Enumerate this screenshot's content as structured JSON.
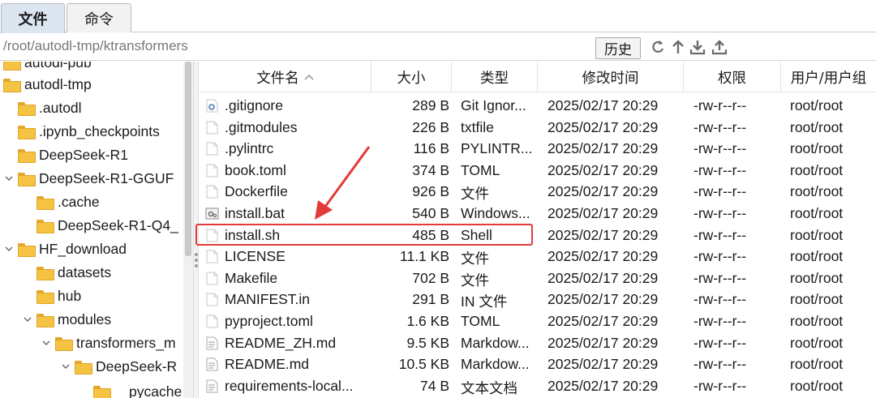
{
  "tabs": [
    {
      "label": "文件",
      "active": true
    },
    {
      "label": "命令",
      "active": false
    }
  ],
  "pathbar": {
    "path": "/root/autodl-tmp/ktransformers",
    "history_label": "历史"
  },
  "tree": {
    "items": [
      {
        "label": "autodl-pub",
        "depth": 0,
        "expanded": false,
        "clipped_top": true
      },
      {
        "label": "autodl-tmp",
        "depth": 0,
        "expanded": true
      },
      {
        "label": ".autodl",
        "depth": 1,
        "expanded": false
      },
      {
        "label": ".ipynb_checkpoints",
        "depth": 1,
        "expanded": false
      },
      {
        "label": "DeepSeek-R1",
        "depth": 1,
        "expanded": false
      },
      {
        "label": "DeepSeek-R1-GGUF",
        "depth": 1,
        "expanded": true
      },
      {
        "label": ".cache",
        "depth": 2,
        "expanded": false
      },
      {
        "label": "DeepSeek-R1-Q4_",
        "depth": 2,
        "expanded": false
      },
      {
        "label": "HF_download",
        "depth": 1,
        "expanded": true
      },
      {
        "label": "datasets",
        "depth": 2,
        "expanded": false
      },
      {
        "label": "hub",
        "depth": 2,
        "expanded": false
      },
      {
        "label": "modules",
        "depth": 2,
        "expanded": true
      },
      {
        "label": "transformers_m",
        "depth": 3,
        "expanded": true
      },
      {
        "label": "DeepSeek-R",
        "depth": 4,
        "expanded": true
      },
      {
        "label": "pycache",
        "depth": 5,
        "expanded": false
      }
    ]
  },
  "file_list": {
    "columns": [
      "文件名",
      "大小",
      "类型",
      "修改时间",
      "权限",
      "用户/用户组"
    ],
    "rows": [
      {
        "name": ".gitignore",
        "size": "289 B",
        "type": "Git Ignor...",
        "modified": "2025/02/17 20:29",
        "perm": "-rw-r--r--",
        "owner": "root/root",
        "icon": "settings-file-icon"
      },
      {
        "name": ".gitmodules",
        "size": "226 B",
        "type": "txtfile",
        "modified": "2025/02/17 20:29",
        "perm": "-rw-r--r--",
        "owner": "root/root",
        "icon": "file-icon"
      },
      {
        "name": ".pylintrc",
        "size": "116 B",
        "type": "PYLINTR...",
        "modified": "2025/02/17 20:29",
        "perm": "-rw-r--r--",
        "owner": "root/root",
        "icon": "file-icon"
      },
      {
        "name": "book.toml",
        "size": "374 B",
        "type": "TOML",
        "modified": "2025/02/17 20:29",
        "perm": "-rw-r--r--",
        "owner": "root/root",
        "icon": "file-icon"
      },
      {
        "name": "Dockerfile",
        "size": "926 B",
        "type": "文件",
        "modified": "2025/02/17 20:29",
        "perm": "-rw-r--r--",
        "owner": "root/root",
        "icon": "file-icon"
      },
      {
        "name": "install.bat",
        "size": "540 B",
        "type": "Windows...",
        "modified": "2025/02/17 20:29",
        "perm": "-rw-r--r--",
        "owner": "root/root",
        "icon": "batch-file-icon"
      },
      {
        "name": "install.sh",
        "size": "485 B",
        "type": "Shell",
        "modified": "2025/02/17 20:29",
        "perm": "-rw-r--r--",
        "owner": "root/root",
        "icon": "file-icon",
        "highlighted": true
      },
      {
        "name": "LICENSE",
        "size": "11.1 KB",
        "type": "文件",
        "modified": "2025/02/17 20:29",
        "perm": "-rw-r--r--",
        "owner": "root/root",
        "icon": "file-icon"
      },
      {
        "name": "Makefile",
        "size": "702 B",
        "type": "文件",
        "modified": "2025/02/17 20:29",
        "perm": "-rw-r--r--",
        "owner": "root/root",
        "icon": "file-icon"
      },
      {
        "name": "MANIFEST.in",
        "size": "291 B",
        "type": "IN 文件",
        "modified": "2025/02/17 20:29",
        "perm": "-rw-r--r--",
        "owner": "root/root",
        "icon": "file-icon"
      },
      {
        "name": "pyproject.toml",
        "size": "1.6 KB",
        "type": "TOML",
        "modified": "2025/02/17 20:29",
        "perm": "-rw-r--r--",
        "owner": "root/root",
        "icon": "file-icon"
      },
      {
        "name": "README_ZH.md",
        "size": "9.5 KB",
        "type": "Markdow...",
        "modified": "2025/02/17 20:29",
        "perm": "-rw-r--r--",
        "owner": "root/root",
        "icon": "text-file-icon"
      },
      {
        "name": "README.md",
        "size": "10.5 KB",
        "type": "Markdow...",
        "modified": "2025/02/17 20:29",
        "perm": "-rw-r--r--",
        "owner": "root/root",
        "icon": "text-file-icon"
      },
      {
        "name": "requirements-local...",
        "size": "74 B",
        "type": "文本文档",
        "modified": "2025/02/17 20:29",
        "perm": "-rw-r--r--",
        "owner": "root/root",
        "icon": "text-file-icon"
      }
    ]
  },
  "colors": {
    "active_tab_bg": "#dce6f1",
    "folder_yellow": "#f4c342",
    "highlight_red": "#e23a3a"
  }
}
